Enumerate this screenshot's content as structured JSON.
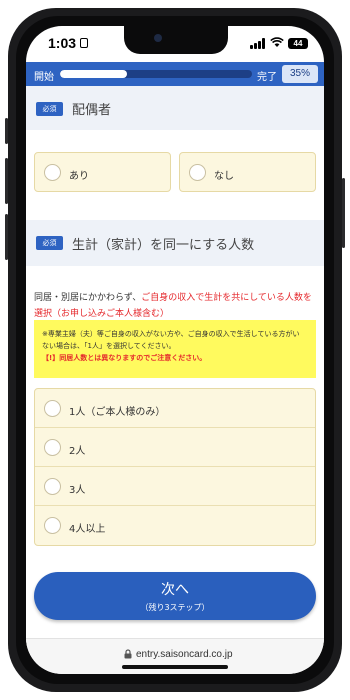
{
  "status_bar": {
    "time": "1:03",
    "battery": "44"
  },
  "progress": {
    "start_label": "開始",
    "end_label": "完了",
    "percent_label": "35%",
    "percent": 0.35
  },
  "spouse": {
    "required_badge": "必須",
    "title": "配偶者",
    "options": [
      "あり",
      "なし"
    ]
  },
  "household": {
    "required_badge": "必須",
    "title": "生計（家計）を同一にする人数",
    "desc_plain": "同居・別居にかかわらず、",
    "desc_red_1": "ご自身の収入で生計を共にしている人数を",
    "desc_red_2": "選択（お申し込みご本人様含む）",
    "note_line_1": "※専業主婦（夫）等ご自身の収入がない方や、ご自身の収入で生活している方がい",
    "note_line_2": "ない場合は、「1人」を選択してください。",
    "note_red": "【!】同居人数とは異なりますのでご注意ください。",
    "options": [
      "1人（ご本人様のみ）",
      "2人",
      "3人",
      "4人以上"
    ]
  },
  "next_button": {
    "label": "次へ",
    "sub_label": "（残り3ステップ）"
  },
  "browser": {
    "url": "entry.saisoncard.co.jp"
  },
  "colors": {
    "accent": "#2e63c2",
    "required_red": "#e5282c",
    "card_bg": "#fcf7df",
    "note_bg": "#fffa5e"
  }
}
